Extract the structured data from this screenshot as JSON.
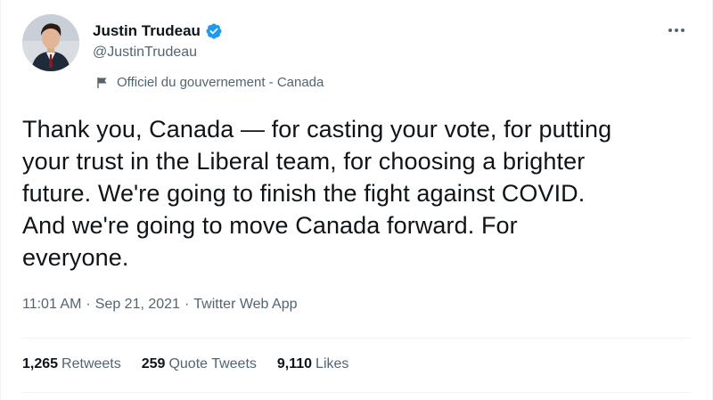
{
  "author": {
    "display_name": "Justin Trudeau",
    "handle": "@JustinTrudeau",
    "verified_icon": "verified-badge-icon",
    "avatar_icon": "profile-photo"
  },
  "gov_label": {
    "icon": "flag-icon",
    "text": "Officiel du gouvernement - Canada"
  },
  "more_menu": {
    "icon": "more-horizontal-icon"
  },
  "tweet": {
    "text": "Thank you, Canada — for casting your vote, for putting\nyour trust in the Liberal team, for choosing a brighter\nfuture. We're going to finish the fight against COVID.\nAnd we're going to move Canada forward. For\neveryone."
  },
  "meta": {
    "time": "11:01 AM",
    "separator": "·",
    "date": "Sep 21, 2021",
    "source": "Twitter Web App"
  },
  "stats": {
    "retweets_count": "1,265",
    "retweets_label": "Retweets",
    "quote_count": "259",
    "quote_label": "Quote Tweets",
    "likes_count": "9,110",
    "likes_label": "Likes"
  },
  "colors": {
    "text": "#0f1419",
    "secondary": "#536471",
    "verified": "#1d9bf0",
    "divider": "#eff3f4"
  }
}
